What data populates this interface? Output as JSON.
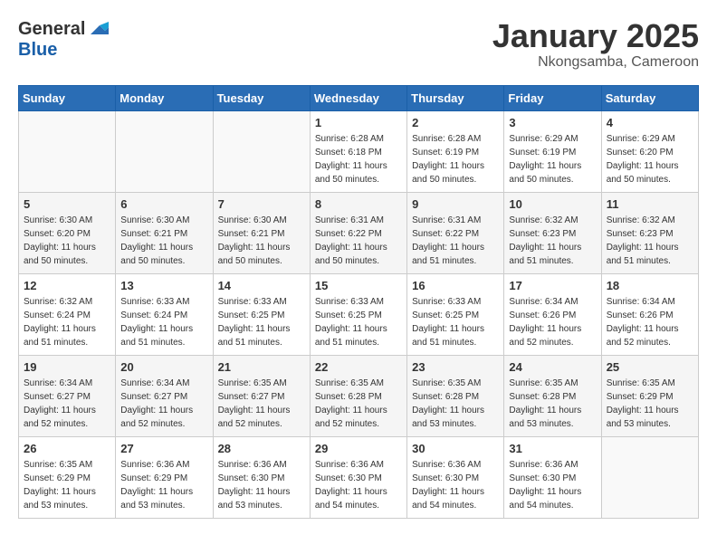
{
  "header": {
    "logo_general": "General",
    "logo_blue": "Blue",
    "month_title": "January 2025",
    "location": "Nkongsamba, Cameroon"
  },
  "days_of_week": [
    "Sunday",
    "Monday",
    "Tuesday",
    "Wednesday",
    "Thursday",
    "Friday",
    "Saturday"
  ],
  "weeks": [
    [
      {
        "day": "",
        "info": ""
      },
      {
        "day": "",
        "info": ""
      },
      {
        "day": "",
        "info": ""
      },
      {
        "day": "1",
        "info": "Sunrise: 6:28 AM\nSunset: 6:18 PM\nDaylight: 11 hours\nand 50 minutes."
      },
      {
        "day": "2",
        "info": "Sunrise: 6:28 AM\nSunset: 6:19 PM\nDaylight: 11 hours\nand 50 minutes."
      },
      {
        "day": "3",
        "info": "Sunrise: 6:29 AM\nSunset: 6:19 PM\nDaylight: 11 hours\nand 50 minutes."
      },
      {
        "day": "4",
        "info": "Sunrise: 6:29 AM\nSunset: 6:20 PM\nDaylight: 11 hours\nand 50 minutes."
      }
    ],
    [
      {
        "day": "5",
        "info": "Sunrise: 6:30 AM\nSunset: 6:20 PM\nDaylight: 11 hours\nand 50 minutes."
      },
      {
        "day": "6",
        "info": "Sunrise: 6:30 AM\nSunset: 6:21 PM\nDaylight: 11 hours\nand 50 minutes."
      },
      {
        "day": "7",
        "info": "Sunrise: 6:30 AM\nSunset: 6:21 PM\nDaylight: 11 hours\nand 50 minutes."
      },
      {
        "day": "8",
        "info": "Sunrise: 6:31 AM\nSunset: 6:22 PM\nDaylight: 11 hours\nand 50 minutes."
      },
      {
        "day": "9",
        "info": "Sunrise: 6:31 AM\nSunset: 6:22 PM\nDaylight: 11 hours\nand 51 minutes."
      },
      {
        "day": "10",
        "info": "Sunrise: 6:32 AM\nSunset: 6:23 PM\nDaylight: 11 hours\nand 51 minutes."
      },
      {
        "day": "11",
        "info": "Sunrise: 6:32 AM\nSunset: 6:23 PM\nDaylight: 11 hours\nand 51 minutes."
      }
    ],
    [
      {
        "day": "12",
        "info": "Sunrise: 6:32 AM\nSunset: 6:24 PM\nDaylight: 11 hours\nand 51 minutes."
      },
      {
        "day": "13",
        "info": "Sunrise: 6:33 AM\nSunset: 6:24 PM\nDaylight: 11 hours\nand 51 minutes."
      },
      {
        "day": "14",
        "info": "Sunrise: 6:33 AM\nSunset: 6:25 PM\nDaylight: 11 hours\nand 51 minutes."
      },
      {
        "day": "15",
        "info": "Sunrise: 6:33 AM\nSunset: 6:25 PM\nDaylight: 11 hours\nand 51 minutes."
      },
      {
        "day": "16",
        "info": "Sunrise: 6:33 AM\nSunset: 6:25 PM\nDaylight: 11 hours\nand 51 minutes."
      },
      {
        "day": "17",
        "info": "Sunrise: 6:34 AM\nSunset: 6:26 PM\nDaylight: 11 hours\nand 52 minutes."
      },
      {
        "day": "18",
        "info": "Sunrise: 6:34 AM\nSunset: 6:26 PM\nDaylight: 11 hours\nand 52 minutes."
      }
    ],
    [
      {
        "day": "19",
        "info": "Sunrise: 6:34 AM\nSunset: 6:27 PM\nDaylight: 11 hours\nand 52 minutes."
      },
      {
        "day": "20",
        "info": "Sunrise: 6:34 AM\nSunset: 6:27 PM\nDaylight: 11 hours\nand 52 minutes."
      },
      {
        "day": "21",
        "info": "Sunrise: 6:35 AM\nSunset: 6:27 PM\nDaylight: 11 hours\nand 52 minutes."
      },
      {
        "day": "22",
        "info": "Sunrise: 6:35 AM\nSunset: 6:28 PM\nDaylight: 11 hours\nand 52 minutes."
      },
      {
        "day": "23",
        "info": "Sunrise: 6:35 AM\nSunset: 6:28 PM\nDaylight: 11 hours\nand 53 minutes."
      },
      {
        "day": "24",
        "info": "Sunrise: 6:35 AM\nSunset: 6:28 PM\nDaylight: 11 hours\nand 53 minutes."
      },
      {
        "day": "25",
        "info": "Sunrise: 6:35 AM\nSunset: 6:29 PM\nDaylight: 11 hours\nand 53 minutes."
      }
    ],
    [
      {
        "day": "26",
        "info": "Sunrise: 6:35 AM\nSunset: 6:29 PM\nDaylight: 11 hours\nand 53 minutes."
      },
      {
        "day": "27",
        "info": "Sunrise: 6:36 AM\nSunset: 6:29 PM\nDaylight: 11 hours\nand 53 minutes."
      },
      {
        "day": "28",
        "info": "Sunrise: 6:36 AM\nSunset: 6:30 PM\nDaylight: 11 hours\nand 53 minutes."
      },
      {
        "day": "29",
        "info": "Sunrise: 6:36 AM\nSunset: 6:30 PM\nDaylight: 11 hours\nand 54 minutes."
      },
      {
        "day": "30",
        "info": "Sunrise: 6:36 AM\nSunset: 6:30 PM\nDaylight: 11 hours\nand 54 minutes."
      },
      {
        "day": "31",
        "info": "Sunrise: 6:36 AM\nSunset: 6:30 PM\nDaylight: 11 hours\nand 54 minutes."
      },
      {
        "day": "",
        "info": ""
      }
    ]
  ]
}
